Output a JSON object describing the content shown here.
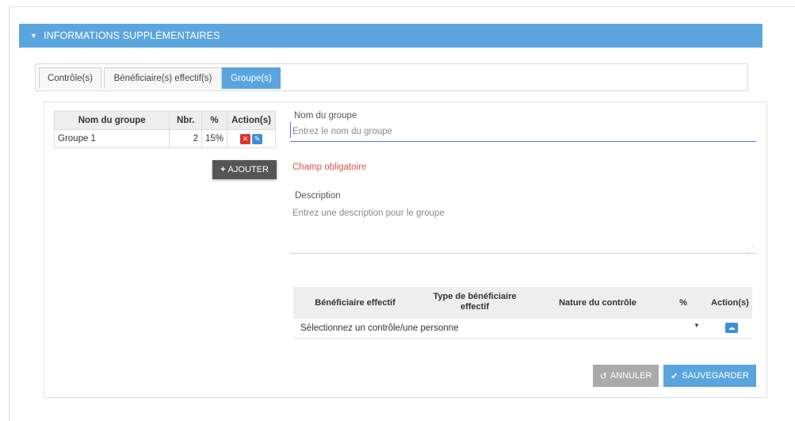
{
  "section": {
    "title": "INFORMATIONS SUPPLÉMENTAIRES",
    "caret_icon": "caret-down-icon"
  },
  "tabs": [
    {
      "label": "Contrôle(s)",
      "active": false
    },
    {
      "label": "Bénéficiaire(s) effectif(s)",
      "active": false
    },
    {
      "label": "Groupe(s)",
      "active": true
    }
  ],
  "groups_table": {
    "headers": {
      "name": "Nom du groupe",
      "count": "Nbr.",
      "percent": "%",
      "actions": "Action(s)"
    },
    "rows": [
      {
        "name": "Groupe 1",
        "count": "2",
        "percent": "15%"
      }
    ]
  },
  "add_button": {
    "label": "AJOUTER",
    "icon": "plus-icon"
  },
  "form": {
    "name_label": "Nom du groupe",
    "name_placeholder": "Entrez le nom du groupe",
    "required_msg": "Champ obligatoire",
    "description_label": "Description",
    "description_placeholder": "Entrez une description pour le groupe"
  },
  "beneficiaries_table": {
    "headers": {
      "beneficiary": "Bénéficiaire effectif",
      "type": "Type de bénéficiaire effectif",
      "nature": "Nature du contrôle",
      "percent": "%",
      "actions": "Action(s)"
    },
    "select_placeholder": "Sélectionnez un contrôle/une personne"
  },
  "buttons": {
    "cancel": "ANNULER",
    "save": "SAUVEGARDER"
  },
  "colors": {
    "accent": "#5aa5de",
    "danger": "#e0322e",
    "dark_button": "#555555",
    "required": "#e14f4f"
  }
}
